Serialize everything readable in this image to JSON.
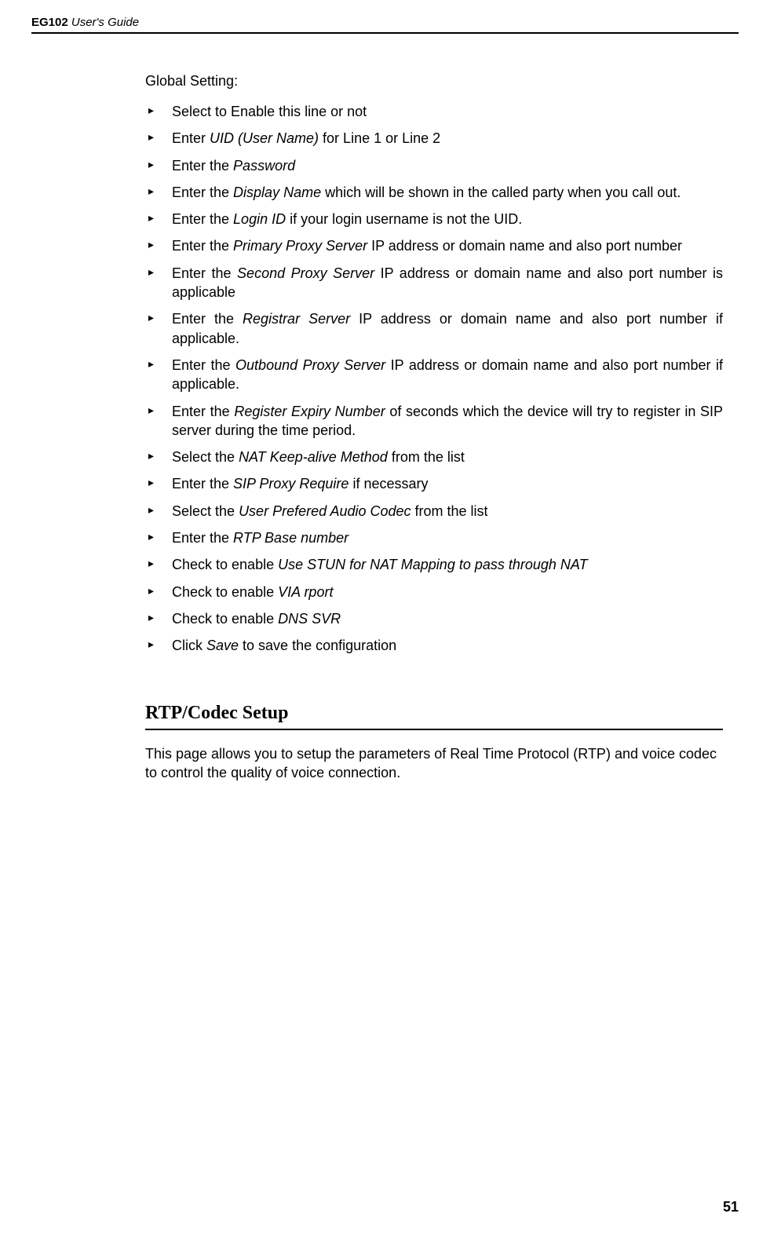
{
  "header": {
    "product": "EG102",
    "subtitle": "User's Guide"
  },
  "globalSettingTitle": "Global Setting:",
  "bullets": [
    {
      "pre": "Select to Enable this line or not"
    },
    {
      "pre": "Enter ",
      "em": "UID (User Name)",
      "post": " for Line 1 or Line 2"
    },
    {
      "pre": "Enter the ",
      "em": "Password",
      "post": ""
    },
    {
      "pre": "Enter the ",
      "em": "Display Name",
      "post": " which will be shown in the called party when you call out."
    },
    {
      "pre": "Enter the ",
      "em": "Login ID",
      "post": " if your login username is not the UID."
    },
    {
      "pre": "Enter the ",
      "em": "Primary Proxy Server",
      "post": " IP address or domain name and also port number"
    },
    {
      "pre": "Enter the ",
      "em": "Second Proxy Server",
      "post": " IP address or domain name and also port number is applicable"
    },
    {
      "pre": "Enter the ",
      "em": "Registrar Server",
      "post": " IP address or domain name and also port number if applicable."
    },
    {
      "pre": "Enter the ",
      "em": "Outbound Proxy Server",
      "post": " IP address or domain name and also port number if applicable."
    },
    {
      "pre": "Enter the ",
      "em": "Register Expiry Number",
      "post": " of seconds which the device will try to register in SIP server during the time period."
    },
    {
      "pre": "Select the ",
      "em": "NAT Keep-alive Method",
      "post": " from the list"
    },
    {
      "pre": "Enter the ",
      "em": "SIP Proxy Require",
      "post": " if necessary"
    },
    {
      "pre": "Select the ",
      "em": "User Prefered Audio Codec",
      "post": " from the list"
    },
    {
      "pre": "Enter the ",
      "em": "RTP Base number",
      "post": ""
    },
    {
      "pre": "Check to enable ",
      "em": "Use STUN for NAT Mapping to pass through NAT",
      "post": ""
    },
    {
      "pre": "Check to enable ",
      "em": "VIA rport",
      "post": ""
    },
    {
      "pre": "Check to enable ",
      "em": "DNS SVR",
      "post": ""
    },
    {
      "pre": "Click ",
      "em": "Save",
      "post": " to save the configuration"
    }
  ],
  "section": {
    "heading": "RTP/Codec Setup",
    "body": "This page allows you to setup the parameters of Real Time Protocol (RTP) and voice codec to control the quality of voice connection."
  },
  "pageNumber": "51"
}
